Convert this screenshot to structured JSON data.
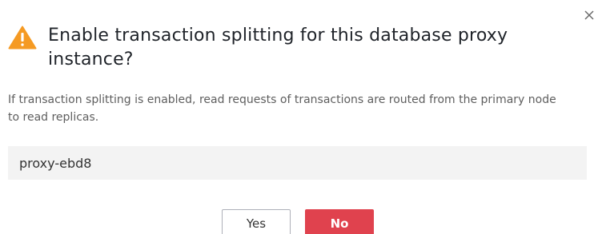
{
  "dialog": {
    "title": "Enable transaction splitting for this database proxy instance?",
    "message": "If transaction splitting is enabled, read requests of transactions are routed from the primary node to read replicas.",
    "proxy_name": "proxy-ebd8",
    "yes_label": "Yes",
    "no_label": "No",
    "icons": {
      "warning": "warning-icon",
      "close": "close-icon"
    },
    "colors": {
      "warning": "#f59a23",
      "danger_button": "#e0424e"
    }
  }
}
